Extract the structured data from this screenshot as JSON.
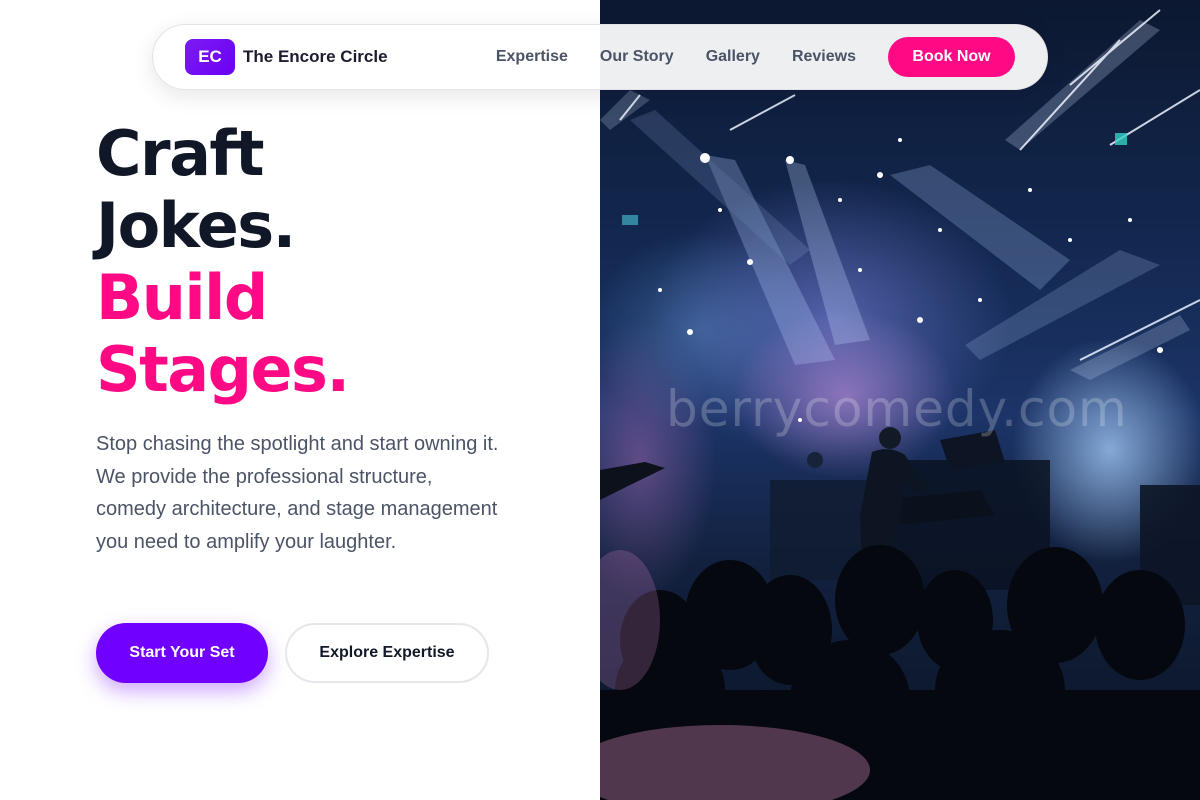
{
  "navbar": {
    "logo_initials": "EC",
    "brand_name": "The Encore Circle",
    "links": [
      "Expertise",
      "Our Story",
      "Gallery",
      "Reviews"
    ],
    "cta_label": "Book Now"
  },
  "hero": {
    "headline_line1": "Craft",
    "headline_line2": "Jokes.",
    "headline_line3": "Build",
    "headline_line4": "Stages.",
    "description": "Stop chasing the spotlight and start owning it. We provide the professional structure, comedy architecture, and stage management you need to amplify your laughter.",
    "primary_button": "Start Your Set",
    "secondary_button": "Explore Expertise"
  },
  "image": {
    "watermark": "berrycomedy.com"
  },
  "colors": {
    "accent_purple": "#7000ff",
    "accent_pink": "#ff0a84",
    "heading_dark": "#101828",
    "body_text": "#4b5366"
  }
}
